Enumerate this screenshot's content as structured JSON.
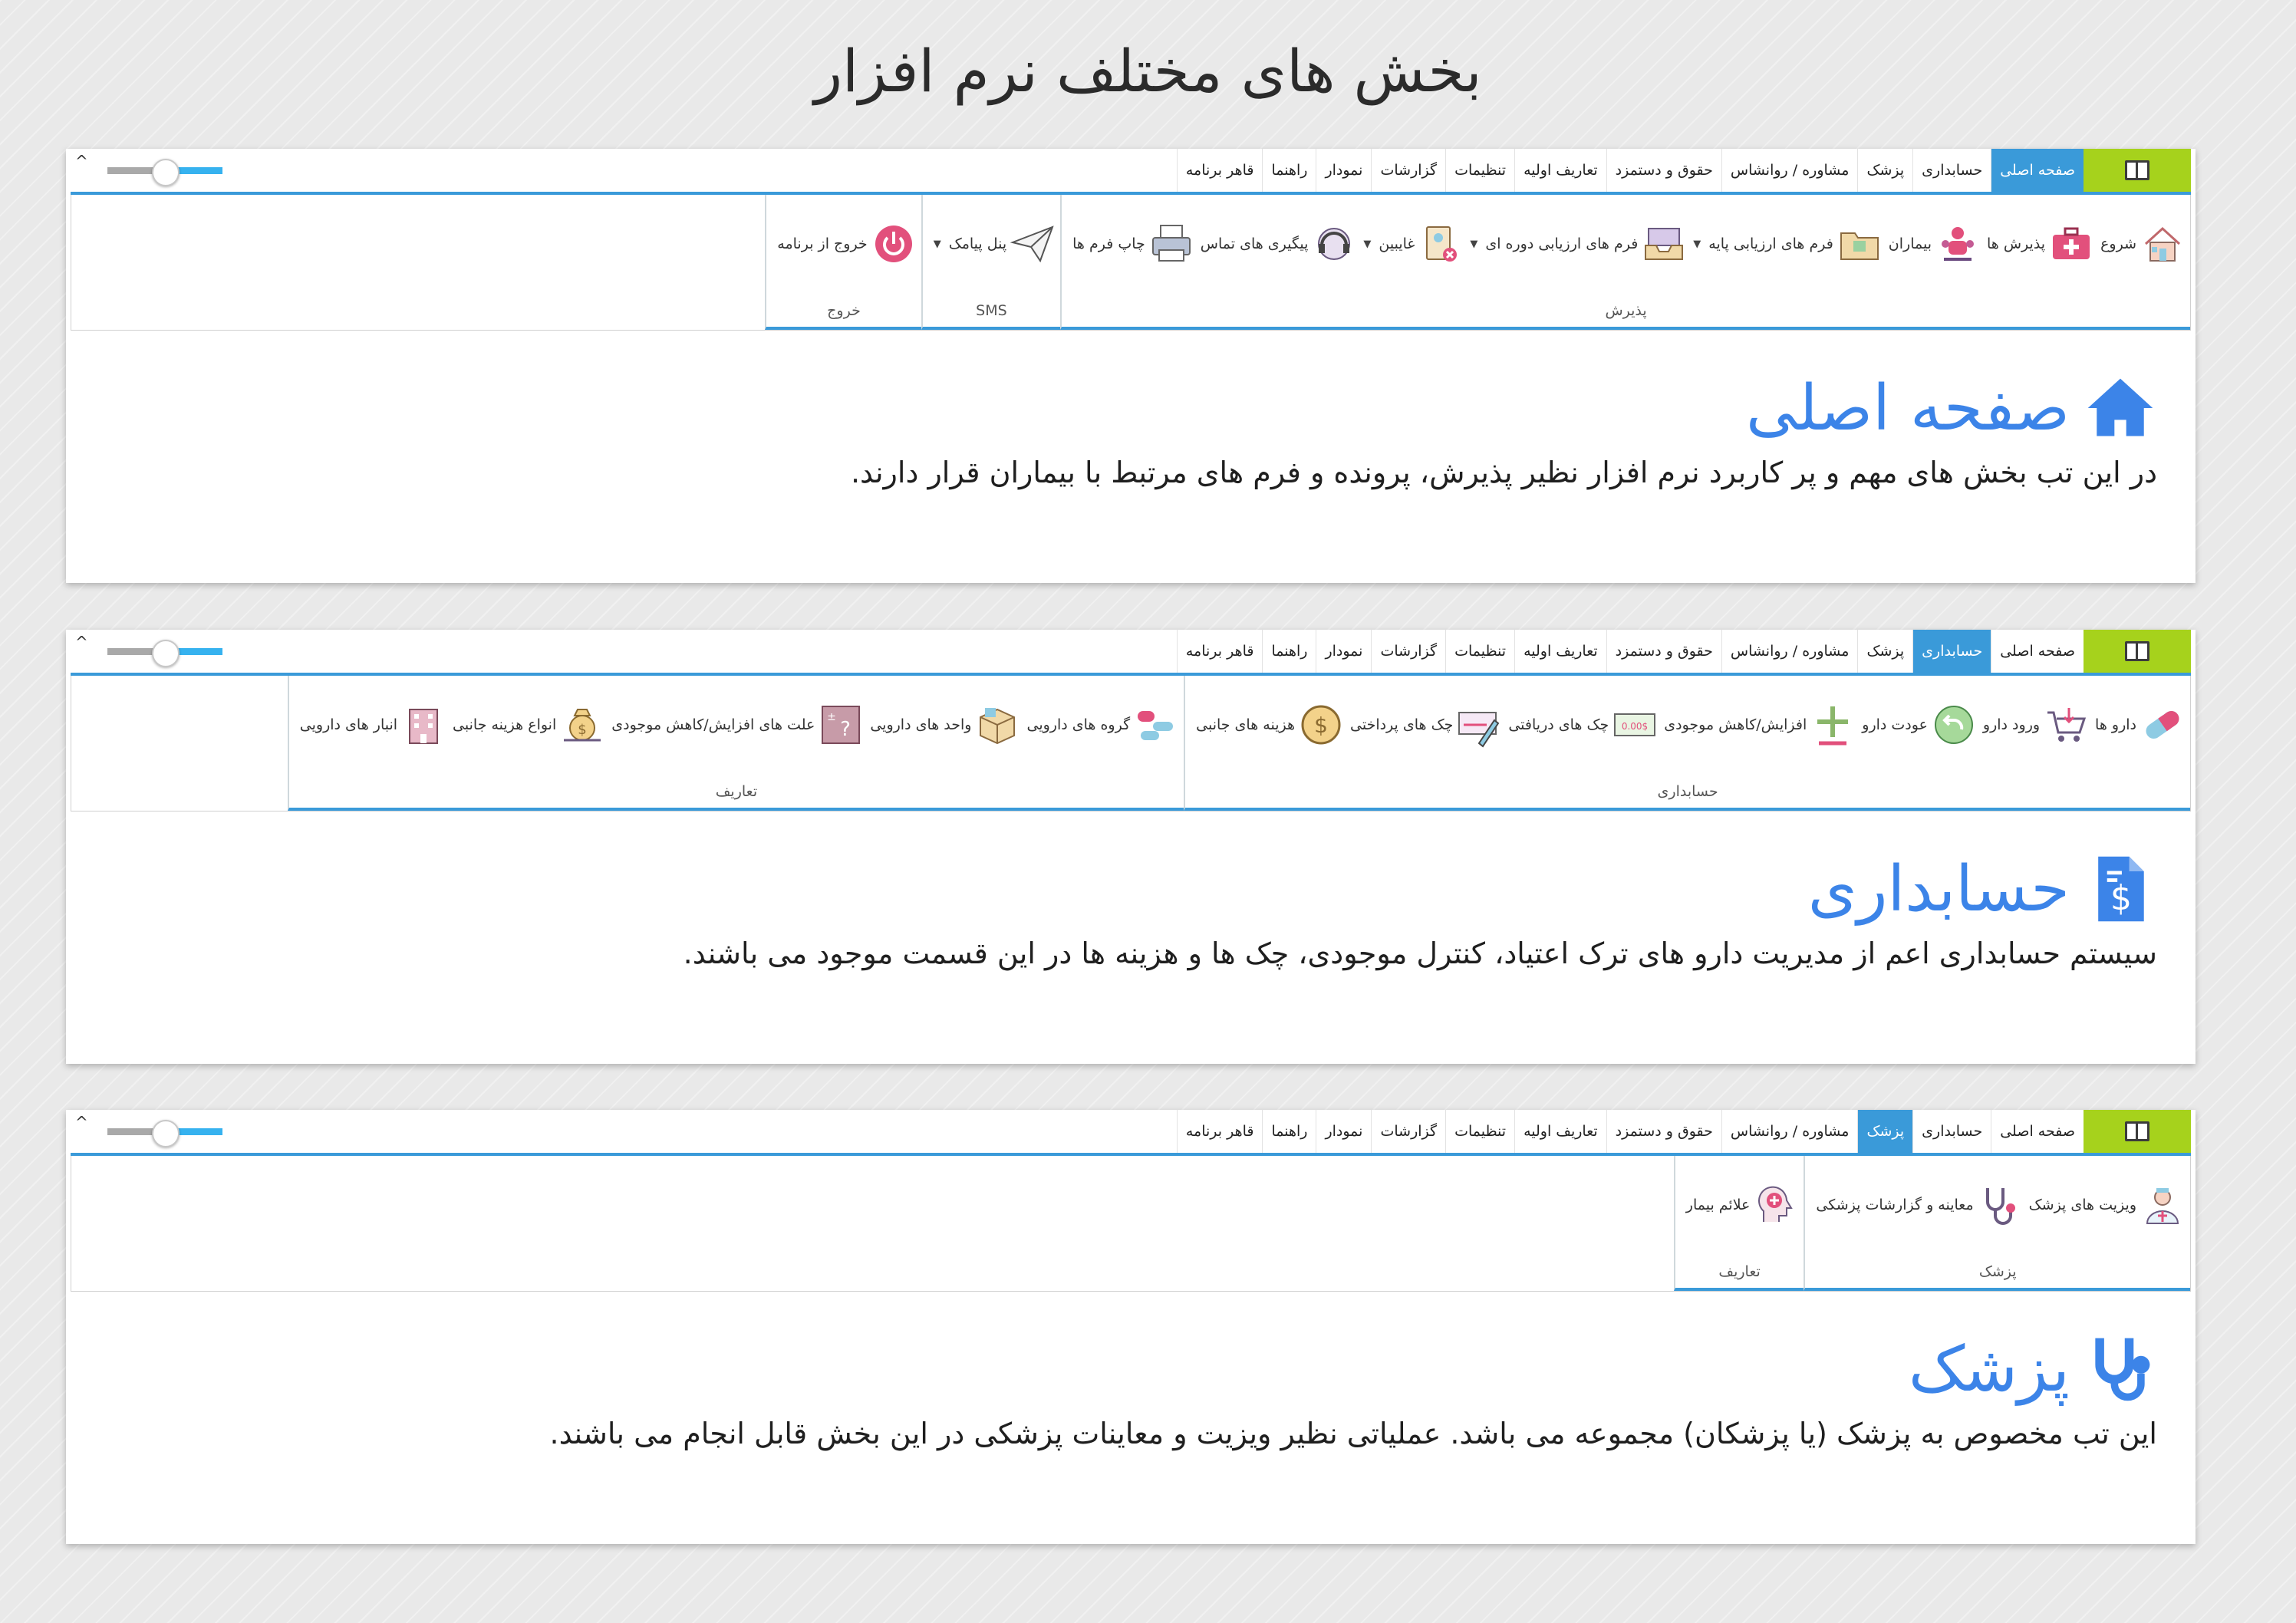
{
  "page": {
    "title": "بخش های مختلف نرم افزار"
  },
  "colors": {
    "accent": "#3a9ad9",
    "appButton": "#a6d21c",
    "sectionTitle": "#3c84e8"
  },
  "panels": [
    {
      "tabs": [
        "صفحه اصلی",
        "حسابداری",
        "پزشک",
        "مشاوره / روانشاس",
        "حقوق و دستمزد",
        "تعاریف اولیه",
        "تنظیمات",
        "گزارشات",
        "نمودار",
        "راهنما",
        "قاهر برنامه"
      ],
      "active": 0,
      "groups": [
        {
          "label": "پذیرش",
          "items": [
            {
              "label": "شروع",
              "icon": "house-icon",
              "dd": false
            },
            {
              "label": "پذیرش ها",
              "icon": "first-aid-kit-icon",
              "dd": false
            },
            {
              "label": "بیماران",
              "icon": "patients-icon",
              "dd": false
            },
            {
              "label": "فرم های ارزیابی پایه",
              "icon": "folder-icon",
              "dd": true
            },
            {
              "label": "فرم های ارزیابی دوره ای",
              "icon": "inbox-tray-icon",
              "dd": true
            },
            {
              "label": "غایبین",
              "icon": "absent-badge-icon",
              "dd": true
            },
            {
              "label": "پیگیری های تماس",
              "icon": "headset-icon",
              "dd": false
            },
            {
              "label": "چاپ فرم ها",
              "icon": "printer-icon",
              "dd": false
            }
          ]
        },
        {
          "label": "SMS",
          "items": [
            {
              "label": "پنل پیامک",
              "icon": "paper-plane-icon",
              "dd": true
            }
          ]
        },
        {
          "label": "خروج",
          "items": [
            {
              "label": "خروج از برنامه",
              "icon": "power-icon",
              "dd": false
            }
          ]
        }
      ],
      "section": {
        "title": "صفحه اصلی",
        "icon": "home-icon",
        "text": "در این تب بخش های مهم و پر کاربرد نرم افزار نظیر پذیرش، پرونده و فرم های مرتبط با بیماران قرار دارند."
      }
    },
    {
      "tabs": [
        "صفحه اصلی",
        "حسابداری",
        "پزشک",
        "مشاوره / روانشاس",
        "حقوق و دستمزد",
        "تعاریف اولیه",
        "تنظیمات",
        "گزارشات",
        "نمودار",
        "راهنما",
        "قاهر برنامه"
      ],
      "active": 1,
      "groups": [
        {
          "label": "حسابداری",
          "items": [
            {
              "label": "دارو ها",
              "icon": "capsule-icon",
              "dd": false
            },
            {
              "label": "ورود دارو",
              "icon": "cart-in-icon",
              "dd": false
            },
            {
              "label": "عودت دارو",
              "icon": "return-icon",
              "dd": false
            },
            {
              "label": "افزایش/کاهش موجودی",
              "icon": "plus-minus-icon",
              "dd": false
            },
            {
              "label": "چک های دریافتی",
              "icon": "cheque-icon",
              "dd": false
            },
            {
              "label": "چک های پرداختی",
              "icon": "cheque-pen-icon",
              "dd": false
            },
            {
              "label": "هزینه های جانبی",
              "icon": "dollar-coin-icon",
              "dd": false
            }
          ]
        },
        {
          "label": "تعاریف",
          "items": [
            {
              "label": "گروه های دارویی",
              "icon": "capsule-group-icon",
              "dd": false
            },
            {
              "label": "واحد های دارویی",
              "icon": "box-icon",
              "dd": false
            },
            {
              "label": "علت های افزایش/کاهش موجودی",
              "icon": "question-box-icon",
              "dd": false
            },
            {
              "label": "انواع هزینه جانبی",
              "icon": "money-bag-icon",
              "dd": false
            },
            {
              "label": "انبار های دارویی",
              "icon": "building-icon",
              "dd": false
            }
          ]
        }
      ],
      "section": {
        "title": "حسابداری",
        "icon": "invoice-dollar-icon",
        "text": "سیستم حسابداری اعم از مدیریت دارو های ترک اعتیاد، کنترل موجودی، چک ها و هزینه ها در این قسمت موجود می باشند."
      }
    },
    {
      "tabs": [
        "صفحه اصلی",
        "حسابداری",
        "پزشک",
        "مشاوره / روانشاس",
        "حقوق و دستمزد",
        "تعاریف اولیه",
        "تنظیمات",
        "گزارشات",
        "نمودار",
        "راهنما",
        "قاهر برنامه"
      ],
      "active": 2,
      "groups": [
        {
          "label": "پزشک",
          "items": [
            {
              "label": "ویزیت های پزشک",
              "icon": "doctor-icon",
              "dd": false
            },
            {
              "label": "معاینه و گزارشات پزشکی",
              "icon": "stethoscope-small-icon",
              "dd": false
            }
          ]
        },
        {
          "label": "تعاریف",
          "items": [
            {
              "label": "علائم بیمار",
              "icon": "head-plus-icon",
              "dd": false
            }
          ]
        }
      ],
      "section": {
        "title": "پزشک",
        "icon": "stethoscope-icon",
        "text": "این تب مخصوص به پزشک (یا پزشکان) مجموعه می باشد. عملیاتی نظیر ویزیت و معاینات پزشکی در این بخش قابل انجام می باشند."
      }
    }
  ]
}
